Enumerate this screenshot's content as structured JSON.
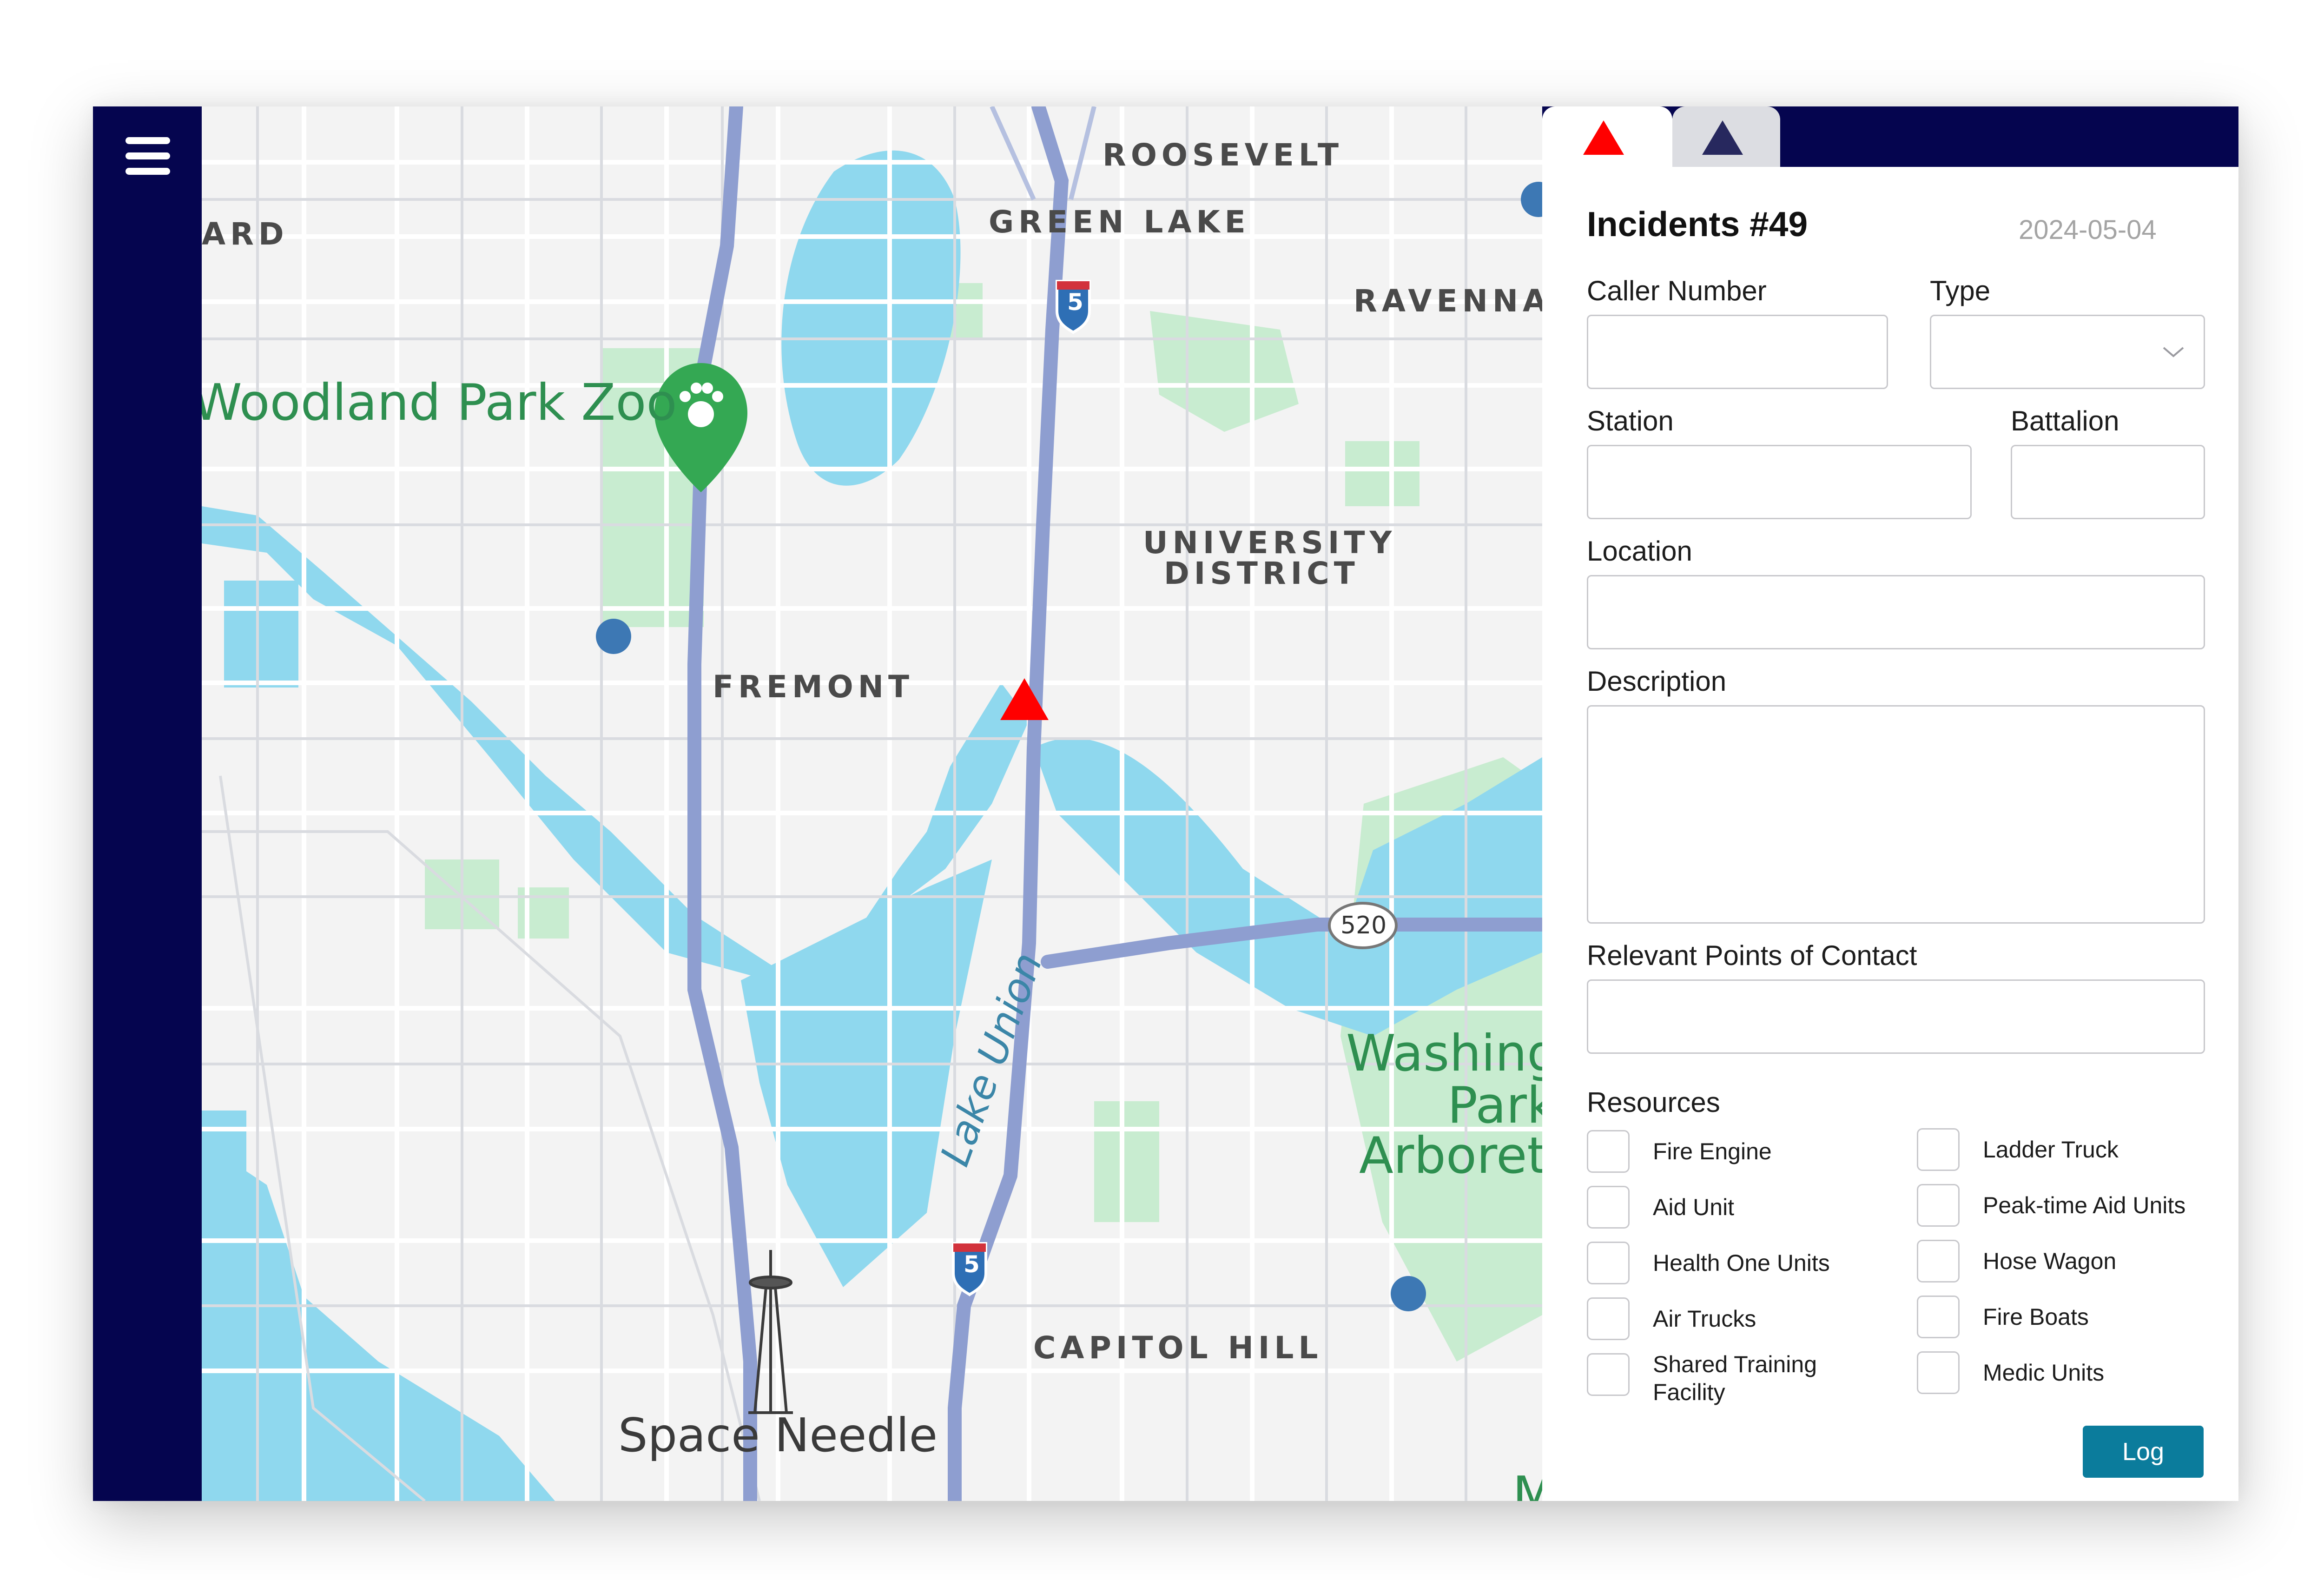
{
  "map": {
    "labels": {
      "roosevelt": "ROOSEVELT",
      "green_lake": "GREEN LAKE",
      "ravenna": "RAVENNA",
      "ballard_partial": "ARD",
      "woodland_park_zoo": "Woodland Park Zoo",
      "university_district_1": "UNIVERSITY",
      "university_district_2": "DISTRICT",
      "fremont": "FREMONT",
      "lake_union": "Lake Union",
      "capitol_hill": "CAPITOL HILL",
      "space_needle": "Space Needle",
      "washington_park_1": "Washington",
      "washington_park_2": "Park",
      "washington_park_3": "Arboretum",
      "madrona_partial": "Madr",
      "highway_5_top": "5",
      "highway_5_bottom": "5",
      "highway_520": "520"
    },
    "colors": {
      "water": "#8fd8ee",
      "park": "#c8ecd0",
      "road": "#ffffff",
      "highway": "#8e9ed0",
      "station_dot": "#3d78b4",
      "incident": "#ff0000"
    }
  },
  "tabs": [
    {
      "icon": "red-triangle-icon",
      "color": "#ff0000"
    },
    {
      "icon": "navy-triangle-icon",
      "color": "#27285e"
    }
  ],
  "form": {
    "title": "Incidents #49",
    "date": "2024-05-04",
    "caller_number": {
      "label": "Caller Number",
      "value": ""
    },
    "type": {
      "label": "Type",
      "value": ""
    },
    "station": {
      "label": "Station",
      "value": ""
    },
    "battalion": {
      "label": "Battalion",
      "value": ""
    },
    "location": {
      "label": "Location",
      "value": ""
    },
    "description": {
      "label": "Description",
      "value": ""
    },
    "contacts": {
      "label": "Relevant Points of Contact",
      "value": ""
    },
    "resources_label": "Resources",
    "resources": {
      "fire_engine": "Fire Engine",
      "aid_unit": "Aid Unit",
      "health_one": "Health One Units",
      "air_trucks": "Air Trucks",
      "shared_training": "Shared Training Facility",
      "ladder_truck": "Ladder Truck",
      "peak_time": "Peak-time Aid Units",
      "hose_wagon": "Hose Wagon",
      "fire_boats": "Fire Boats",
      "medic_units": "Medic Units"
    },
    "log_button": "Log"
  }
}
